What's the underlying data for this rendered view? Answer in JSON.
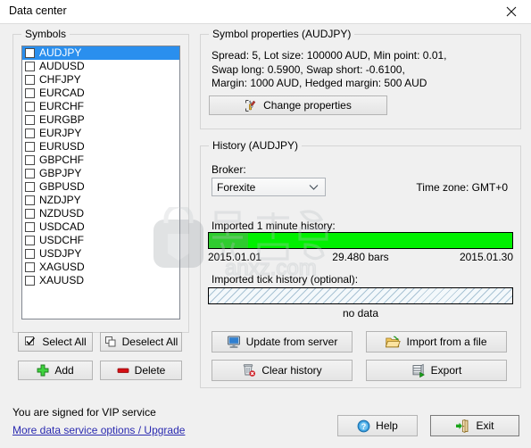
{
  "window": {
    "title": "Data center",
    "close_icon": "close-icon"
  },
  "symbols_panel": {
    "legend": "Symbols",
    "items": [
      {
        "label": "AUDJPY",
        "checked": false,
        "selected": true
      },
      {
        "label": "AUDUSD",
        "checked": false,
        "selected": false
      },
      {
        "label": "CHFJPY",
        "checked": false,
        "selected": false
      },
      {
        "label": "EURCAD",
        "checked": false,
        "selected": false
      },
      {
        "label": "EURCHF",
        "checked": false,
        "selected": false
      },
      {
        "label": "EURGBP",
        "checked": false,
        "selected": false
      },
      {
        "label": "EURJPY",
        "checked": false,
        "selected": false
      },
      {
        "label": "EURUSD",
        "checked": false,
        "selected": false
      },
      {
        "label": "GBPCHF",
        "checked": false,
        "selected": false
      },
      {
        "label": "GBPJPY",
        "checked": false,
        "selected": false
      },
      {
        "label": "GBPUSD",
        "checked": false,
        "selected": false
      },
      {
        "label": "NZDJPY",
        "checked": false,
        "selected": false
      },
      {
        "label": "NZDUSD",
        "checked": false,
        "selected": false
      },
      {
        "label": "USDCAD",
        "checked": false,
        "selected": false
      },
      {
        "label": "USDCHF",
        "checked": false,
        "selected": false
      },
      {
        "label": "USDJPY",
        "checked": false,
        "selected": false
      },
      {
        "label": "XAGUSD",
        "checked": false,
        "selected": false
      },
      {
        "label": "XAUUSD",
        "checked": false,
        "selected": false
      }
    ],
    "buttons": {
      "select_all": "Select All",
      "deselect_all": "Deselect All",
      "add": "Add",
      "delete": "Delete"
    },
    "button_icons": {
      "select_all": "checkbox-check-icon",
      "deselect_all": "two-squares-icon",
      "add": "green-plus-icon",
      "delete": "red-minus-icon"
    }
  },
  "properties_panel": {
    "legend": "Symbol properties (AUDJPY)",
    "details": "Spread: 5, Lot size: 100000 AUD, Min point: 0.01,\nSwap long: 0.5900, Swap short: -0.6100,\nMargin: 1000 AUD, Hedged margin: 500 AUD",
    "change_button": "Change properties",
    "change_button_icon": "wrench-screwdriver-icon"
  },
  "history_panel": {
    "legend": "History (AUDJPY)",
    "broker_label": "Broker:",
    "broker_value": "Forexite",
    "broker_options": [
      "Forexite"
    ],
    "timezone": "Time zone: GMT+0",
    "minute_history_label": "Imported 1 minute history:",
    "minute_bar": {
      "start_date": "2015.01.01",
      "bars_text": "29.480 bars",
      "end_date": "2015.01.30",
      "dim_pct": 13,
      "fill_pct": 87,
      "dim_color": "#2fcc2f",
      "fill_color": "#00f000"
    },
    "tick_history_label": "Imported tick history (optional):",
    "tick_status": "no data",
    "buttons": {
      "update_from_server": "Update from server",
      "import_from_file": "Import from a file",
      "clear_history": "Clear history",
      "export": "Export"
    },
    "button_icons": {
      "update_from_server": "monitor-icon",
      "import_from_file": "open-folder-icon",
      "clear_history": "trash-delete-icon",
      "export": "database-export-icon"
    }
  },
  "footer": {
    "status": "You are signed for VIP service",
    "link": "More data service options / Upgrade",
    "help_button": "Help",
    "help_icon": "question-circle-icon",
    "exit_button": "Exit",
    "exit_icon": "exit-door-icon",
    "link_color": "#2a2ab0"
  },
  "watermark": {
    "text": "anxz.com"
  }
}
